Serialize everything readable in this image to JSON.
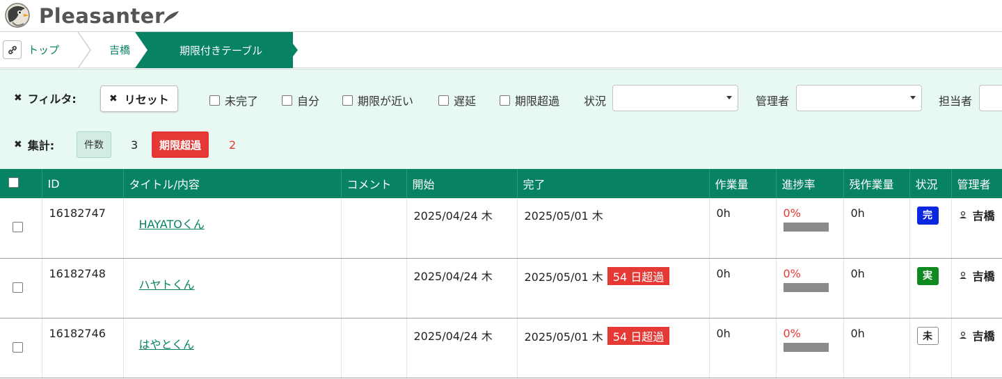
{
  "app": {
    "name": "Pleasanter"
  },
  "breadcrumb": {
    "items": [
      "トップ",
      "吉橋",
      "期限付きテーブル"
    ]
  },
  "filters": {
    "label": "フィルタ:",
    "reset": "リセット",
    "checkboxes": [
      "未完了",
      "自分",
      "期限が近い",
      "遅延",
      "期限超過"
    ],
    "selects": [
      {
        "label": "状況",
        "value": ""
      },
      {
        "label": "管理者",
        "value": ""
      },
      {
        "label": "担当者",
        "value": ""
      }
    ]
  },
  "aggregations": {
    "label": "集計:",
    "count_label": "件数",
    "count_value": "3",
    "overdue_label": "期限超過",
    "overdue_value": "2"
  },
  "colors": {
    "accent": "#078263",
    "filter_bg": "#e8f8f2",
    "overdue": "#e53935"
  },
  "table": {
    "columns": [
      "ID",
      "タイトル/内容",
      "コメント",
      "開始",
      "完了",
      "作業量",
      "進捗率",
      "残作業量",
      "状況",
      "管理者"
    ],
    "rows": [
      {
        "id": "16182747",
        "title": "HAYATOくん",
        "comment": "",
        "start": "2025/04/24 木",
        "end": "2025/05/01 木",
        "overdue": "",
        "work": "0h",
        "progress": "0%",
        "remaining": "0h",
        "status": "完",
        "status_color": "#0b27e0",
        "manager": "吉橋"
      },
      {
        "id": "16182748",
        "title": "ハヤトくん",
        "comment": "",
        "start": "2025/04/24 木",
        "end": "2025/05/01 木",
        "overdue": "54 日超過",
        "work": "0h",
        "progress": "0%",
        "remaining": "0h",
        "status": "実",
        "status_color": "#0f8a21",
        "manager": "吉橋"
      },
      {
        "id": "16182746",
        "title": "はやとくん",
        "comment": "",
        "start": "2025/04/24 木",
        "end": "2025/05/01 木",
        "overdue": "54 日超過",
        "work": "0h",
        "progress": "0%",
        "remaining": "0h",
        "status": "未",
        "status_color": "#ffffff",
        "manager": "吉橋"
      }
    ]
  }
}
